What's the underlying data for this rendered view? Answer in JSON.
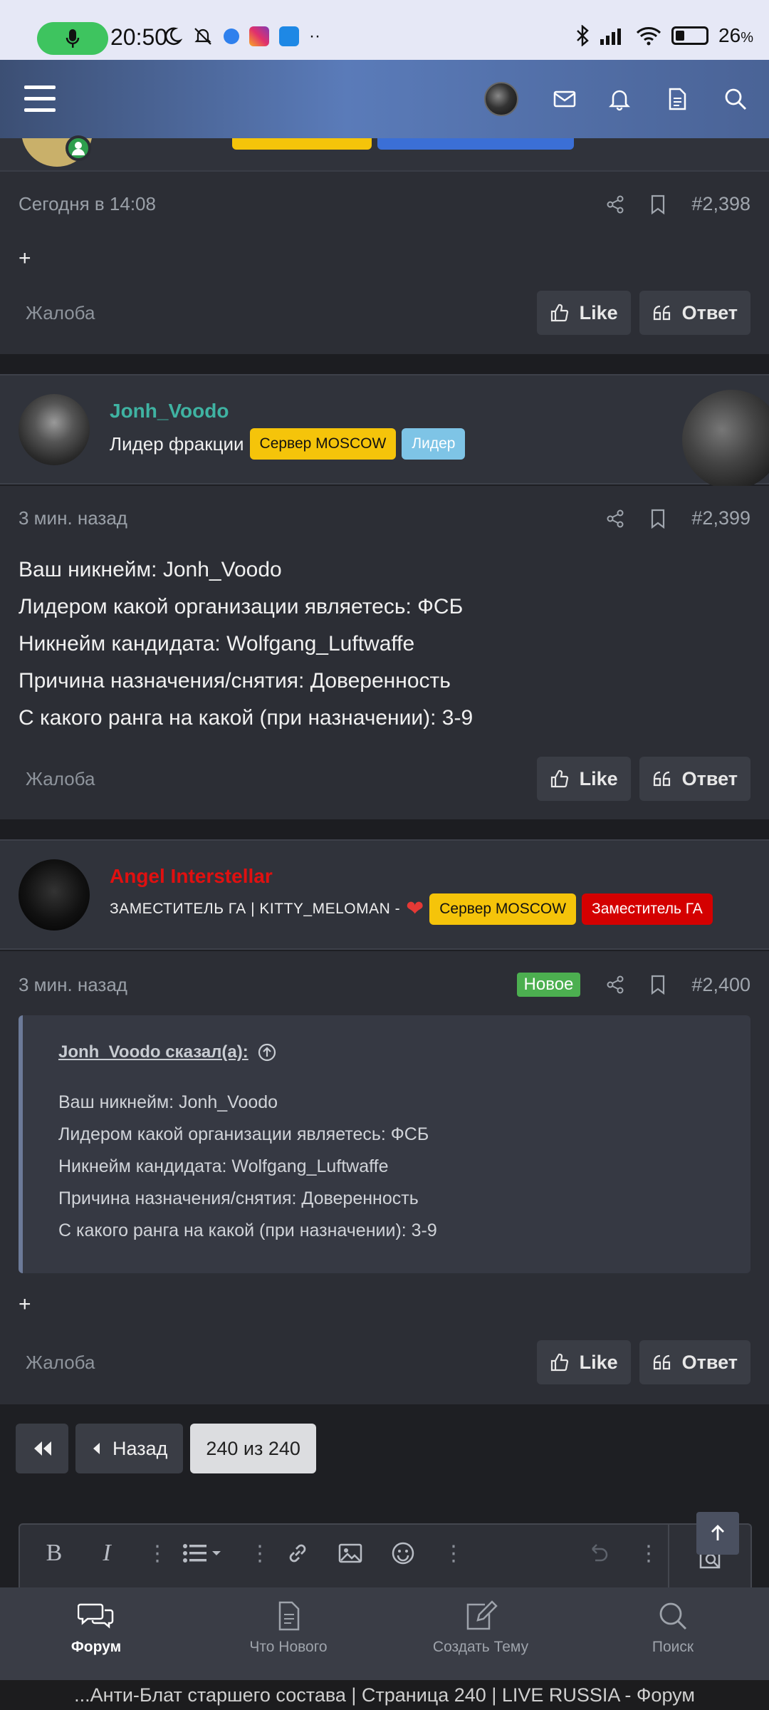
{
  "status_bar": {
    "time": "20:50",
    "battery": "26",
    "battery_unit": "%"
  },
  "header": {
    "icons": [
      "menu-icon",
      "avatar",
      "mail-icon",
      "bell-icon",
      "document-icon",
      "search-icon"
    ]
  },
  "post_2398": {
    "time": "Сегодня в 14:08",
    "number": "#2,398",
    "body": "+",
    "report": "Жалоба",
    "like": "Like",
    "reply": "Ответ"
  },
  "post_2399": {
    "author": "Jonh_Voodo",
    "author_color": "#3fb3a2",
    "title": "Лидер фракции",
    "badges": [
      "Сервер MOSCOW",
      "Лидер"
    ],
    "time": "3 мин. назад",
    "number": "#2,399",
    "lines": [
      "Ваш никнейм: Jonh_Voodo",
      "Лидером какой организации являетесь: ФСБ",
      "Никнейм кандидата: Wolfgang_Luftwaffe",
      "Причина назначения/снятия: Доверенность",
      "С какого ранга на какой (при назначении): 3-9"
    ],
    "report": "Жалоба",
    "like": "Like",
    "reply": "Ответ"
  },
  "post_2400": {
    "author": "Angel Interstellar",
    "author_color": "#e01010",
    "title": "ЗАМЕСТИТЕЛЬ ГА | KITTY_MELOMAN -",
    "badges": [
      "Сервер MOSCOW",
      "Заместитель ГА"
    ],
    "time": "3 мин. назад",
    "new_label": "Новое",
    "number": "#2,400",
    "quote_header": "Jonh_Voodo сказал(а):",
    "quote_lines": [
      "Ваш никнейм: Jonh_Voodo",
      "Лидером какой организации являетесь: ФСБ",
      "Никнейм кандидата: Wolfgang_Luftwaffe",
      "Причина назначения/снятия: Доверенность",
      "С какого ранга на какой (при назначении): 3-9"
    ],
    "body": "+",
    "report": "Жалоба",
    "like": "Like",
    "reply": "Ответ"
  },
  "pagination": {
    "back_label": "Назад",
    "current": "240 из 240"
  },
  "bottom_nav": [
    {
      "label": "Форум",
      "icon": "forum-icon",
      "active": true
    },
    {
      "label": "Что Нового",
      "icon": "whats-new-icon",
      "active": false
    },
    {
      "label": "Создать Тему",
      "icon": "create-topic-icon",
      "active": false
    },
    {
      "label": "Поиск",
      "icon": "search-icon",
      "active": false
    }
  ],
  "browser_title": "...Анти-Блат старшего состава | Страница 240 | LIVE RUSSIA - Форум",
  "colors": {
    "badge_server": "#f5c40a",
    "badge_leader": "#7ec4e6",
    "badge_deputy": "#d40000",
    "new_badge": "#4caf50"
  }
}
